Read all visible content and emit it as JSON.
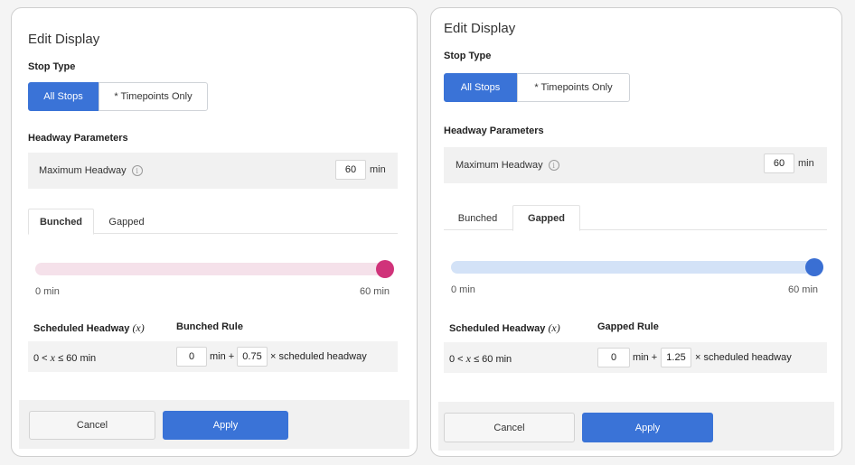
{
  "panels": [
    {
      "title": "Edit Display",
      "stop_type": {
        "label": "Stop Type",
        "options": [
          "All Stops",
          "* Timepoints Only"
        ],
        "selected": "All Stops"
      },
      "headway_parameters": {
        "label": "Headway Parameters",
        "max_headway_label": "Maximum Headway",
        "max_headway_value": "60",
        "unit": "min"
      },
      "tabs": [
        "Bunched",
        "Gapped"
      ],
      "active_tab": "Bunched",
      "slider": {
        "min_label": "0 min",
        "max_label": "60 min",
        "value_fraction": 1.0,
        "track_color": "#f5e1ea",
        "thumb_color": "#d0337a"
      },
      "rule_table": {
        "col1_header": "Scheduled Headway",
        "col1_var": "(x)",
        "col2_header": "Bunched Rule",
        "range_prefix": "0 <",
        "range_var": "x",
        "range_suffix": "≤ 60 min",
        "min_value": "0",
        "min_plus": "min +",
        "multiplier_value": "0.75",
        "multiplier_text": "× scheduled headway"
      },
      "buttons": {
        "cancel": "Cancel",
        "apply": "Apply"
      }
    },
    {
      "title": "Edit Display",
      "stop_type": {
        "label": "Stop Type",
        "options": [
          "All Stops",
          "* Timepoints Only"
        ],
        "selected": "All Stops"
      },
      "headway_parameters": {
        "label": "Headway Parameters",
        "max_headway_label": "Maximum Headway",
        "max_headway_value": "60",
        "unit": "min"
      },
      "tabs": [
        "Bunched",
        "Gapped"
      ],
      "active_tab": "Gapped",
      "slider": {
        "min_label": "0 min",
        "max_label": "60 min",
        "value_fraction": 1.0,
        "track_color": "#d3e2f7",
        "thumb_color": "#3a6fd3"
      },
      "rule_table": {
        "col1_header": "Scheduled Headway",
        "col1_var": "(x)",
        "col2_header": "Gapped Rule",
        "range_prefix": "0 <",
        "range_var": "x",
        "range_suffix": "≤ 60 min",
        "min_value": "0",
        "min_plus": "min +",
        "multiplier_value": "1.25",
        "multiplier_text": "× scheduled headway"
      },
      "buttons": {
        "cancel": "Cancel",
        "apply": "Apply"
      }
    }
  ]
}
